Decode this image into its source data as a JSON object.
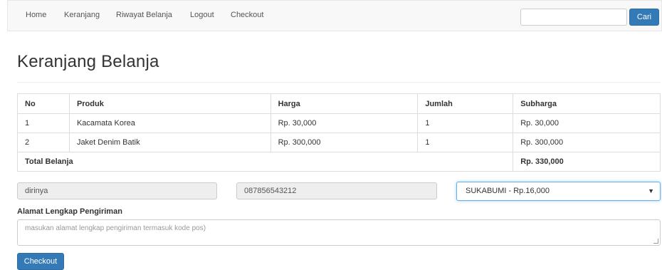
{
  "navbar": {
    "links": [
      "Home",
      "Keranjang",
      "Riwayat Belanja",
      "Logout",
      "Checkout"
    ],
    "search": {
      "value": "",
      "placeholder": "",
      "button_label": "Cari"
    }
  },
  "page": {
    "title": "Keranjang Belanja"
  },
  "cart": {
    "headers": [
      "No",
      "Produk",
      "Harga",
      "Jumlah",
      "Subharga"
    ],
    "rows": [
      [
        "1",
        "Kacamata Korea",
        "Rp. 30,000",
        "1",
        "Rp. 30,000"
      ],
      [
        "2",
        "Jaket Denim Batik",
        "Rp. 300,000",
        "1",
        "Rp. 300,000"
      ]
    ],
    "total_label": "Total Belanja",
    "total_value": "Rp. 330,000"
  },
  "form": {
    "name_value": "dirinya",
    "phone_value": "087856543212",
    "city_selected": "SUKABUMI - Rp.16,000",
    "address_label": "Alamat Lengkap Pengiriman",
    "address_placeholder": "masukan alamat lengkap pengiriman termasuk kode pos)",
    "checkout_label": "Checkout"
  },
  "colors": {
    "primary": "#337ab7",
    "navbar_bg": "#f8f8f8",
    "readonly_bg": "#eeeeee"
  }
}
